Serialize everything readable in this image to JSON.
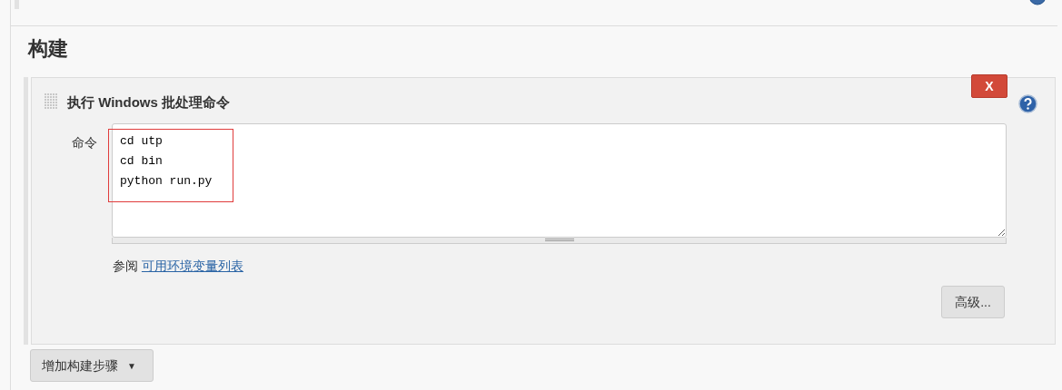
{
  "section": {
    "title": "构建"
  },
  "build_step": {
    "title": "执行 Windows 批处理命令",
    "delete_button": "X",
    "field_label": "命令",
    "command": "cd utp\ncd bin\npython run.py",
    "highlighted": true,
    "see_also": "参阅",
    "env_link": "可用环境变量列表",
    "advanced_button": "高级..."
  },
  "add_step_button": {
    "label": "增加构建步骤",
    "caret": "▼"
  }
}
